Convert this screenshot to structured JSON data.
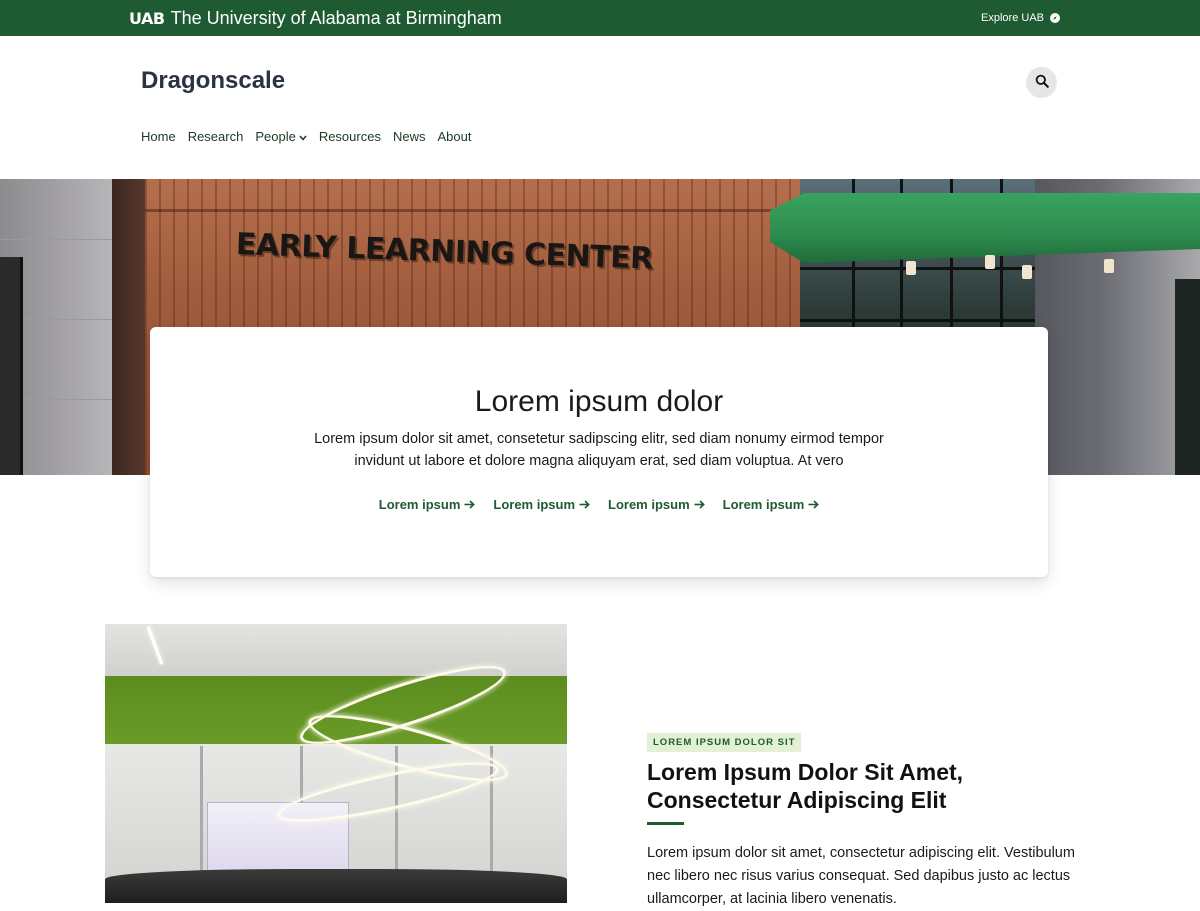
{
  "topbar": {
    "brand_mark": "UAB",
    "brand_name": "The University of Alabama at Birmingham",
    "explore_label": "Explore UAB",
    "explore_icon": "compass-icon",
    "background_color": "#1e5b32"
  },
  "header": {
    "site_title": "Dragonscale",
    "search_icon": "search-icon"
  },
  "nav": {
    "items": [
      {
        "label": "Home"
      },
      {
        "label": "Research"
      },
      {
        "label": "People",
        "has_dropdown": true
      },
      {
        "label": "Resources"
      },
      {
        "label": "News"
      },
      {
        "label": "About"
      }
    ]
  },
  "hero": {
    "sign_text": "EARLY LEARNING CENTER",
    "card": {
      "title": "Lorem ipsum dolor",
      "body": "Lorem ipsum dolor sit amet, consetetur sadipscing elitr, sed diam nonumy eirmod tempor invidunt ut labore et dolore magna aliquyam erat, sed diam voluptua. At vero",
      "links": [
        {
          "label": "Lorem ipsum"
        },
        {
          "label": "Lorem ipsum"
        },
        {
          "label": "Lorem ipsum"
        },
        {
          "label": "Lorem ipsum"
        }
      ]
    }
  },
  "feature": {
    "eyebrow": "LOREM IPSUM DOLOR SIT",
    "title": "Lorem Ipsum Dolor Sit Amet, Consectetur Adipiscing Elit",
    "body": "Lorem ipsum dolor sit amet, consectetur adipiscing elit. Vestibulum nec libero nec risus varius consequat. Sed dapibus justo ac lectus ullamcorper, at lacinia libero venenatis.",
    "accent_color": "#1e5b32",
    "eyebrow_bg": "#e2f0d3"
  }
}
